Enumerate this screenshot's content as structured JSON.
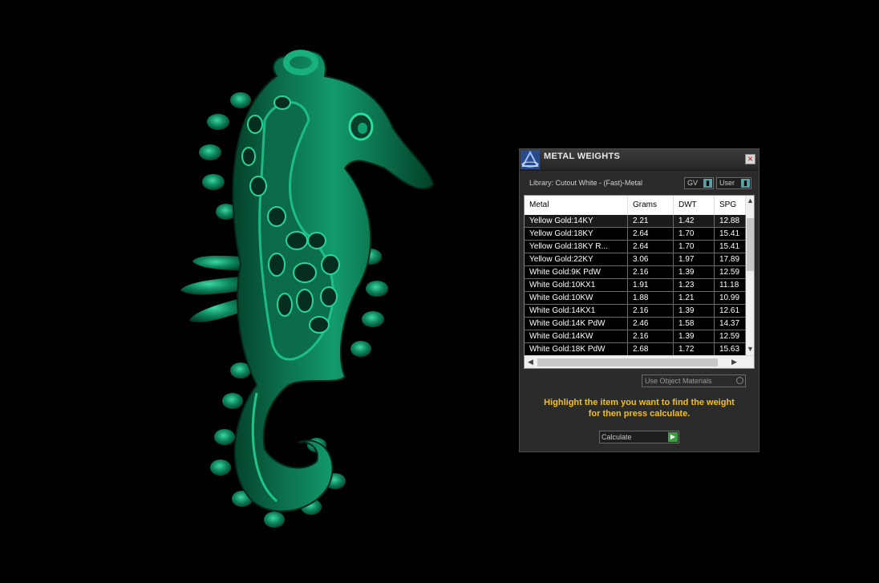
{
  "window": {
    "title": "METAL WEIGHTS",
    "close_label": "×"
  },
  "library_label": "Library: Cutout White - (Fast)-Metal",
  "selects": {
    "gv": "GV",
    "user": "User"
  },
  "table": {
    "headers": [
      "Metal",
      "Grams",
      "DWT",
      "SPG"
    ],
    "rows": [
      [
        "Yellow Gold:14KY",
        "2.21",
        "1.42",
        "12.88"
      ],
      [
        "Yellow Gold:18KY",
        "2.64",
        "1.70",
        "15.41"
      ],
      [
        "Yellow Gold:18KY R...",
        "2.64",
        "1.70",
        "15.41"
      ],
      [
        "Yellow Gold:22KY",
        "3.06",
        "1.97",
        "17.89"
      ],
      [
        "White Gold:9K PdW",
        "2.16",
        "1.39",
        "12.59"
      ],
      [
        "White Gold:10KX1",
        "1.91",
        "1.23",
        "11.18"
      ],
      [
        "White Gold:10KW",
        "1.88",
        "1.21",
        "10.99"
      ],
      [
        "White Gold:14KX1",
        "2.16",
        "1.39",
        "12.61"
      ],
      [
        "White Gold:14K PdW",
        "2.46",
        "1.58",
        "14.37"
      ],
      [
        "White Gold:14KW",
        "2.16",
        "1.39",
        "12.59"
      ],
      [
        "White Gold:18K PdW",
        "2.68",
        "1.72",
        "15.63"
      ]
    ],
    "selected_row": 0
  },
  "use_object_materials_label": "Use Object Materials",
  "hint": {
    "line1": "Highlight the item you want to find the weight",
    "line2": "for then press calculate."
  },
  "calculate_label": "Calculate",
  "colors": {
    "seahorse": "#0f8a63",
    "hint": "#f0c020",
    "accent": "#5aa0a8"
  }
}
